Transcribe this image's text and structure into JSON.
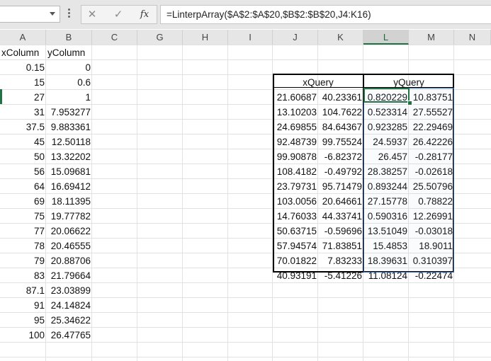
{
  "formula_bar": {
    "formula": "=LinterpArray($A$2:$A$20,$B$2:$B$20,J4:K16)",
    "fx_label": "fx",
    "cancel_icon": "✕",
    "enter_icon": "✓"
  },
  "columns": [
    "A",
    "B",
    "C",
    "G",
    "H",
    "I",
    "J",
    "K",
    "L",
    "M",
    "N"
  ],
  "selected_column": "L",
  "sheet": {
    "headers": {
      "x": "xColumn",
      "y": "yColumn"
    },
    "x": [
      "0.15",
      "15",
      "27",
      "31",
      "37.5",
      "45",
      "50",
      "56",
      "64",
      "69",
      "75",
      "77",
      "78",
      "79",
      "83",
      "87.1",
      "91",
      "95",
      "100"
    ],
    "y": [
      "0",
      "0.6",
      "1",
      "7.953277",
      "9.883361",
      "12.50118",
      "13.32202",
      "15.09681",
      "16.69412",
      "18.11395",
      "19.77782",
      "20.06622",
      "20.46555",
      "20.88706",
      "21.79664",
      "23.03899",
      "24.14824",
      "25.34622",
      "26.47765"
    ]
  },
  "query": {
    "header_x": "xQuery",
    "header_y": "yQuery",
    "rows": [
      [
        "21.60687",
        "40.23361",
        "0.820229",
        "10.83751"
      ],
      [
        "13.10203",
        "104.7622",
        "0.523314",
        "27.55527"
      ],
      [
        "24.69855",
        "84.64367",
        "0.923285",
        "22.29469"
      ],
      [
        "92.48739",
        "99.75524",
        "24.5937",
        "26.42226"
      ],
      [
        "99.90878",
        "-6.82372",
        "26.457",
        "-0.28177"
      ],
      [
        "108.4182",
        "-0.49792",
        "28.38257",
        "-0.02618"
      ],
      [
        "23.79731",
        "95.71479",
        "0.893244",
        "25.50796"
      ],
      [
        "103.0056",
        "20.64661",
        "27.15778",
        "0.78822"
      ],
      [
        "14.76033",
        "44.33741",
        "0.590316",
        "12.26991"
      ],
      [
        "50.63715",
        "-0.59696",
        "13.51049",
        "-0.03018"
      ],
      [
        "57.94574",
        "71.83851",
        "15.4853",
        "18.9011"
      ],
      [
        "70.01822",
        "7.83233",
        "18.39631",
        "0.310397"
      ],
      [
        "40.93191",
        "-5.41226",
        "11.08124",
        "-0.22474"
      ]
    ]
  }
}
